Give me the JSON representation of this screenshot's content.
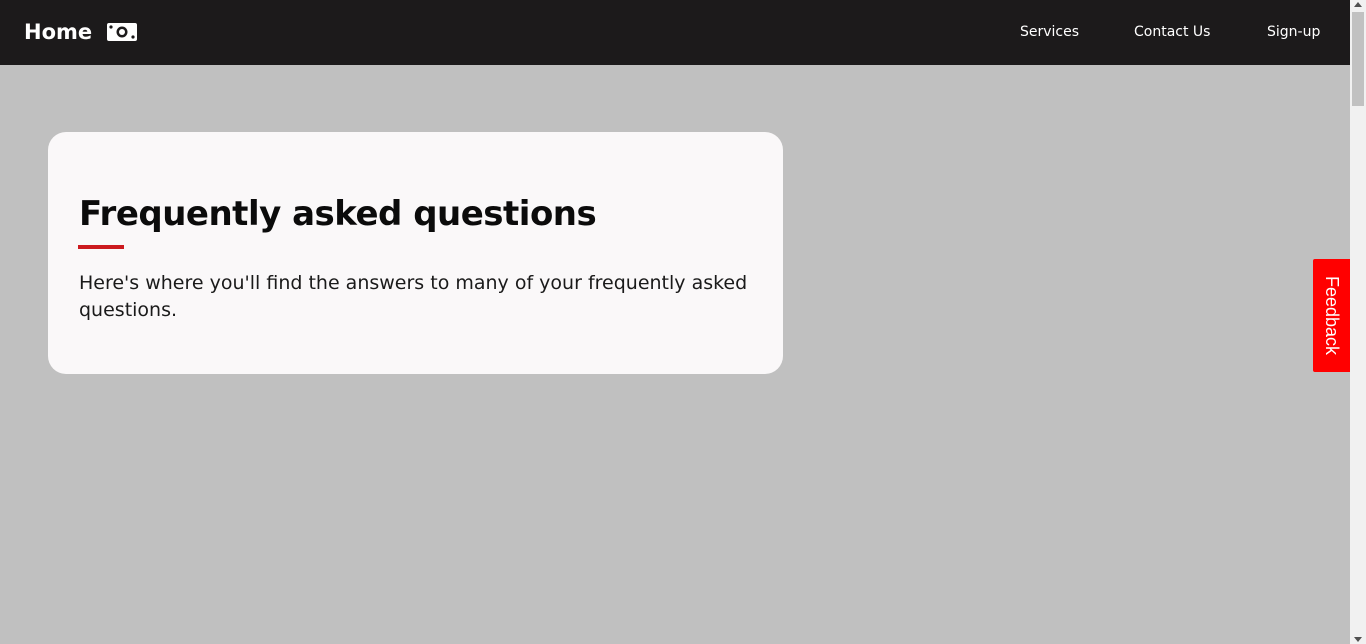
{
  "navbar": {
    "brand_label": "Home",
    "brand_icon": "money-bill-icon",
    "links": [
      {
        "label": "Services"
      },
      {
        "label": "Contact Us"
      },
      {
        "label": "Sign-up"
      }
    ]
  },
  "faq": {
    "title": "Frequently asked questions",
    "description": "Here's where you'll find the answers to many of your frequently asked questions."
  },
  "feedback": {
    "label": "Feedback"
  },
  "colors": {
    "navbar_bg": "#1c1a1b",
    "page_bg": "#c0c0c0",
    "card_bg": "#faf8f9",
    "accent_red": "#cc1a1f",
    "feedback_bg": "#ff0000"
  }
}
